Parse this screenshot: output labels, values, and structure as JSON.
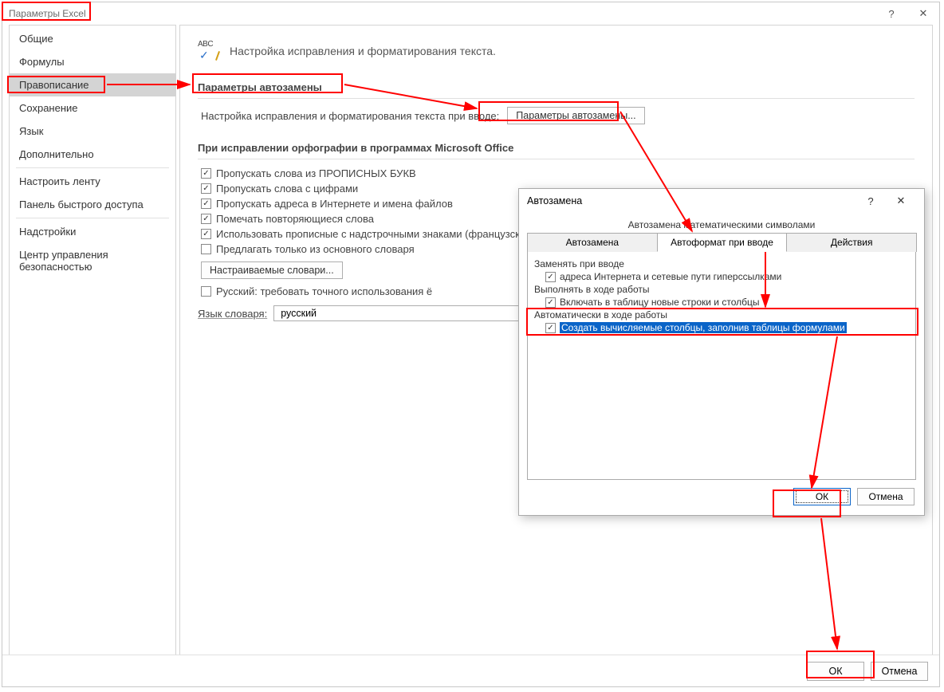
{
  "titlebar": {
    "title": "Параметры Excel",
    "help": "?",
    "close": "✕"
  },
  "sidebar": {
    "items": [
      {
        "label": "Общие"
      },
      {
        "label": "Формулы"
      },
      {
        "label": "Правописание",
        "selected": true
      },
      {
        "label": "Сохранение"
      },
      {
        "label": "Язык"
      },
      {
        "label": "Дополнительно"
      },
      {
        "label": "Настроить ленту",
        "sepBefore": true
      },
      {
        "label": "Панель быстрого доступа"
      },
      {
        "label": "Надстройки",
        "sepBefore": true
      },
      {
        "label": "Центр управления безопасностью"
      }
    ]
  },
  "heading": "Настройка исправления и форматирования текста.",
  "sec1": {
    "title": "Параметры автозамены",
    "label": "Настройка исправления и форматирования текста при вводе:",
    "button": "Параметры автозамены..."
  },
  "sec2": {
    "title": "При исправлении орфографии в программах Microsoft Office",
    "checks": [
      {
        "checked": true,
        "label": "Пропускать слова из ПРОПИСНЫХ БУКВ"
      },
      {
        "checked": true,
        "label": "Пропускать слова с цифрами"
      },
      {
        "checked": true,
        "label": "Пропускать адреса в Интернете и имена файлов"
      },
      {
        "checked": true,
        "label": "Помечать повторяющиеся слова"
      },
      {
        "checked": true,
        "label": "Использовать прописные с надстрочными знаками (французский)"
      },
      {
        "checked": false,
        "label": "Предлагать только из основного словаря"
      }
    ],
    "dictBtn": "Настраиваемые словари...",
    "ruCheck": {
      "checked": false,
      "label": "Русский: требовать точного использования ё"
    },
    "langLabel": "Язык словаря:",
    "langValue": "русский"
  },
  "footer": {
    "ok": "ОК",
    "cancel": "Отмена"
  },
  "inner": {
    "title": "Автозамена",
    "help": "?",
    "close": "✕",
    "mathTab": "Автозамена математическими символами",
    "tabs": [
      "Автозамена",
      "Автоформат при вводе",
      "Действия"
    ],
    "activeTab": 1,
    "g1": {
      "label": "Заменять при вводе",
      "checks": [
        {
          "checked": true,
          "label": "адреса Интернета и сетевые пути гиперссылками"
        }
      ]
    },
    "g2": {
      "label": "Выполнять в ходе работы",
      "checks": [
        {
          "checked": true,
          "label": "Включать в таблицу новые строки и столбцы"
        }
      ]
    },
    "g3": {
      "label": "Автоматически в ходе работы",
      "checks": [
        {
          "checked": true,
          "label": "Создать вычисляемые столбцы, заполнив таблицы формулами",
          "highlight": true
        }
      ]
    },
    "ok": "ОК",
    "cancel": "Отмена"
  },
  "icons": {
    "abc": "ABC"
  }
}
